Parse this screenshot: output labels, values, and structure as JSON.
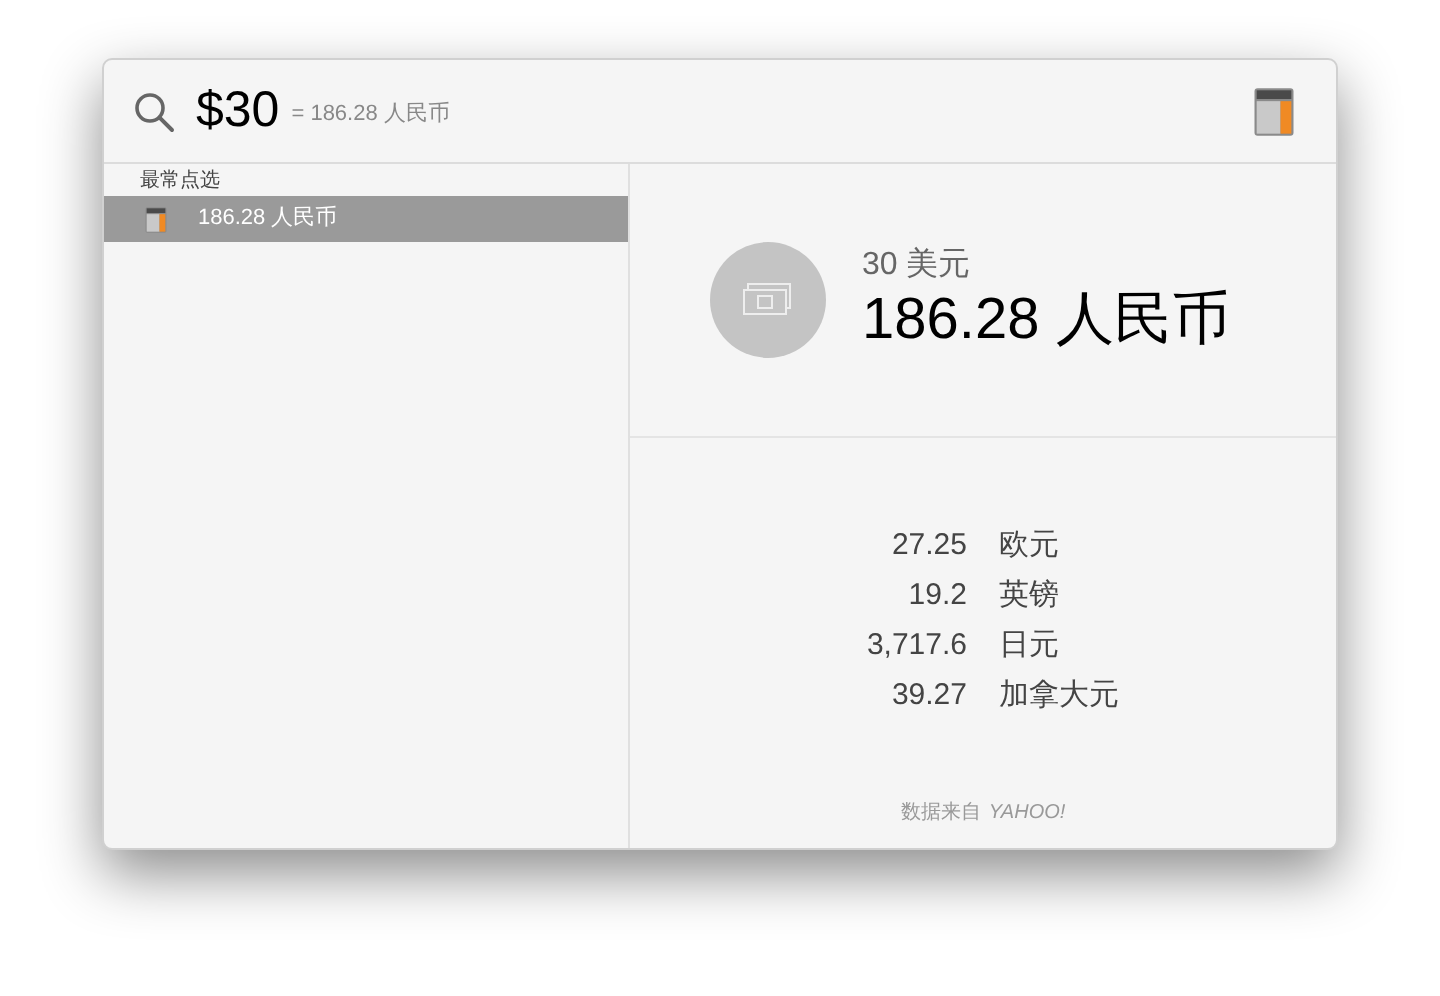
{
  "search": {
    "value": "$30",
    "hint": "= 186.28 人民币"
  },
  "sidebar": {
    "section": "最常点选",
    "items": [
      {
        "label": "186.28 人民币",
        "selected": true
      }
    ]
  },
  "result": {
    "source": "30 美元",
    "converted": "186.28 人民币"
  },
  "conversions": [
    {
      "amount": "27.25",
      "currency": "欧元"
    },
    {
      "amount": "19.2",
      "currency": "英镑"
    },
    {
      "amount": "3,717.6",
      "currency": "日元"
    },
    {
      "amount": "39.27",
      "currency": "加拿大元"
    }
  ],
  "footer": {
    "label": "数据来自",
    "brand": "YAHOO!"
  }
}
